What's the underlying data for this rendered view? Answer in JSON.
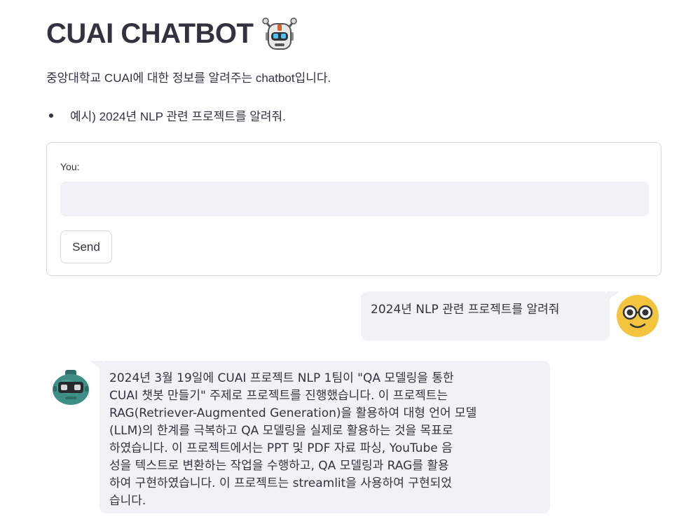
{
  "header": {
    "title": "CUAI CHATBOT",
    "title_emoji_icon": "robot-face-icon"
  },
  "intro": {
    "text": "중앙대학교 CUAI에 대한 정보를 알려주는 chatbot입니다."
  },
  "examples": [
    "예시) 2024년 NLP 관련 프로젝트를 알려줘."
  ],
  "form": {
    "label": "You:",
    "input_value": "",
    "input_placeholder": "",
    "send_label": "Send"
  },
  "chat": {
    "user_message": "2024년 NLP 관련 프로젝트를 알려줘",
    "user_avatar_icon": "nerd-face-icon",
    "bot_avatar_icon": "bot-avatar-icon",
    "bot_message": "2024년 3월 19일에 CUAI 프로젝트 NLP 1팀이 \"QA 모델링을 통한\nCUAI 챗봇 만들기\" 주제로 프로젝트를 진행했습니다. 이 프로젝트는\nRAG(Retriever-Augmented Generation)을 활용하여 대형 언어 모델\n(LLM)의 한계를 극복하고 QA 모델링을 실제로 활용하는 것을 목표로\n하였습니다. 이 프로젝트에서는 PPT 및 PDF 자료 파싱, YouTube 음\n성을 텍스트로 변환하는 작업을 수행하고, QA 모델링과 RAG를 활용\n하여 구현하였습니다. 이 프로젝트는 streamlit을 사용하여 구현되었\n습니다."
  },
  "colors": {
    "text": "#31333f",
    "bubble_bg": "#f0f2f6",
    "input_bg": "#f0f2f6",
    "border": "#d6d6d9",
    "user_avatar": "#f3c43e",
    "bot_avatar": "#3f8f86"
  }
}
